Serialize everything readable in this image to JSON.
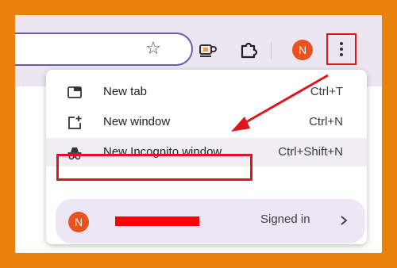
{
  "profile_initial": "N",
  "menu": {
    "items": [
      {
        "icon": "new-tab-icon",
        "label": "New tab",
        "shortcut": "Ctrl+T"
      },
      {
        "icon": "new-window-icon",
        "label": "New window",
        "shortcut": "Ctrl+N"
      },
      {
        "icon": "incognito-icon",
        "label": "New Incognito window",
        "shortcut": "Ctrl+Shift+N"
      }
    ],
    "profile": {
      "initial": "N",
      "status": "Signed in"
    }
  },
  "colors": {
    "background": "#e8820c",
    "toolbar": "#ece6f2",
    "avatar": "#e8521e",
    "annotation": "#e0141e",
    "highlight": "#f0eef2",
    "profile_card": "#ede6f5"
  }
}
